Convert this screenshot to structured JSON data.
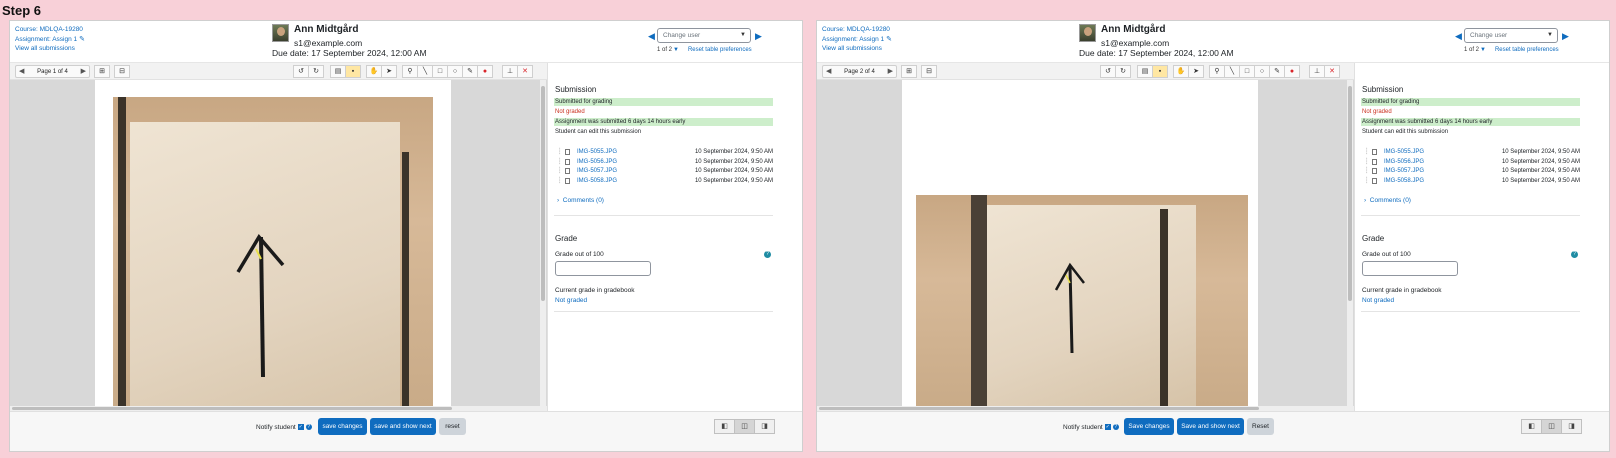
{
  "step_title": "Step 6",
  "screens": [
    {
      "header": {
        "course": "Course: MDLQA-19280",
        "assignment": "Assignment: Assign 1",
        "view_all": "View all submissions",
        "user_name": "Ann Midtgård",
        "user_email": "s1@example.com",
        "due_date": "Due date: 17 September 2024, 12:00 AM",
        "change_user_placeholder": "Change user",
        "user_count": "1 of 2",
        "reset_table": "Reset table preferences"
      },
      "toolbar": {
        "page_label": "Page 1 of 4"
      },
      "submission": {
        "title": "Submission",
        "status_submitted": "Submitted for grading",
        "status_grade": "Not graded",
        "status_early": "Assignment was submitted 6 days 14 hours early",
        "status_edit": "Student can edit this submission",
        "files": [
          {
            "name": "IMG-5055.JPG",
            "date": "10 September 2024, 9:50 AM"
          },
          {
            "name": "IMG-5056.JPG",
            "date": "10 September 2024, 9:50 AM"
          },
          {
            "name": "IMG-5057.JPG",
            "date": "10 September 2024, 9:50 AM"
          },
          {
            "name": "IMG-5058.JPG",
            "date": "10 September 2024, 9:50 AM"
          }
        ],
        "comments": "Comments (0)"
      },
      "grade": {
        "title": "Grade",
        "grade_out_of": "Grade out of 100",
        "gradebook_label": "Current grade in gradebook",
        "gradebook_value": "Not graded"
      },
      "footer": {
        "notify": "Notify student",
        "save": "save changes",
        "save_next": "save and show next",
        "reset": "reset"
      }
    },
    {
      "header": {
        "course": "Course: MDLQA-19280",
        "assignment": "Assignment: Assign 1",
        "view_all": "View all submissions",
        "user_name": "Ann Midtgård",
        "user_email": "s1@example.com",
        "due_date": "Due date: 17 September 2024, 12:00 AM",
        "change_user_placeholder": "Change user",
        "user_count": "1 of 2",
        "reset_table": "Reset table preferences"
      },
      "toolbar": {
        "page_label": "Page 2 of 4"
      },
      "submission": {
        "title": "Submission",
        "status_submitted": "Submitted for grading",
        "status_grade": "Not graded",
        "status_early": "Assignment was submitted 6 days 14 hours early",
        "status_edit": "Student can edit this submission",
        "files": [
          {
            "name": "IMG-5055.JPG",
            "date": "10 September 2024, 9:50 AM"
          },
          {
            "name": "IMG-5056.JPG",
            "date": "10 September 2024, 9:50 AM"
          },
          {
            "name": "IMG-5057.JPG",
            "date": "10 September 2024, 9:50 AM"
          },
          {
            "name": "IMG-5058.JPG",
            "date": "10 September 2024, 9:50 AM"
          }
        ],
        "comments": "Comments (0)"
      },
      "grade": {
        "title": "Grade",
        "grade_out_of": "Grade out of 100",
        "gradebook_label": "Current grade in gradebook",
        "gradebook_value": "Not graded"
      },
      "footer": {
        "notify": "Notify student",
        "save": "Save changes",
        "save_next": "Save and show next",
        "reset": "Reset"
      }
    }
  ]
}
